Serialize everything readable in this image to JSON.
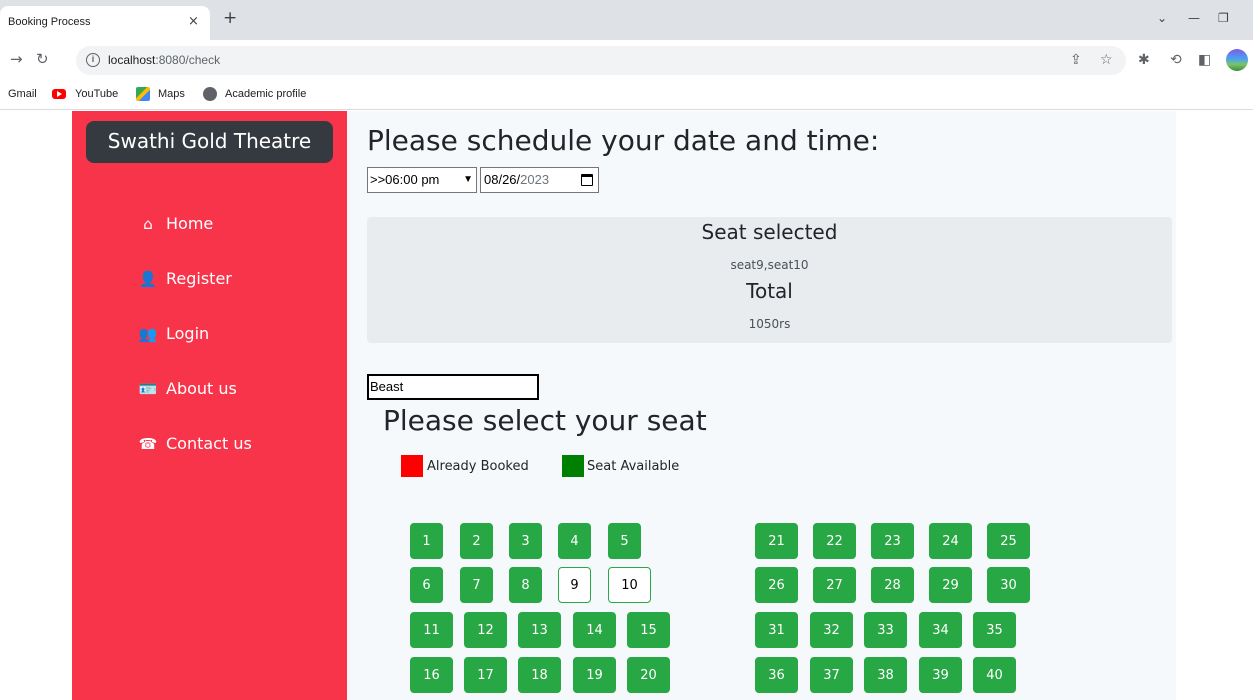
{
  "browser": {
    "tab_title": "Booking Process",
    "tab_close": "×",
    "new_tab": "+",
    "url_host": "localhost",
    "url_rest": ":8080/check",
    "bookmarks": [
      "Gmail",
      "YouTube",
      "Maps",
      "Academic profile"
    ]
  },
  "sidebar": {
    "brand": "Swathi Gold Theatre",
    "items": [
      {
        "label": "Home",
        "icon": "home-icon",
        "glyph": "⌂"
      },
      {
        "label": "Register",
        "icon": "user-plus-icon",
        "glyph": "👤"
      },
      {
        "label": "Login",
        "icon": "users-icon",
        "glyph": "👥"
      },
      {
        "label": "About us",
        "icon": "id-card-icon",
        "glyph": "🪪"
      },
      {
        "label": "Contact us",
        "icon": "phone-icon",
        "glyph": "☎"
      }
    ]
  },
  "schedule": {
    "title": "Please schedule your date and time:",
    "time_value": ">>06:00 pm",
    "date_mmdd": "08/26/",
    "date_year": "2023"
  },
  "summary": {
    "seat_heading": "Seat selected",
    "seats": "seat9,seat10",
    "total_heading": "Total",
    "total_value": "1050rs"
  },
  "movie": {
    "value": "Beast"
  },
  "seat_section": {
    "title": "Please select your seat",
    "legend_booked": "Already Booked",
    "legend_available": "Seat Available",
    "booked_color": "#ff0000",
    "available_color": "#008000",
    "seat_color": "#28a745"
  },
  "seats": {
    "left": [
      [
        "1",
        "2",
        "3",
        "4",
        "5"
      ],
      [
        "6",
        "7",
        "8",
        "9",
        "10"
      ],
      [
        "11",
        "12",
        "13",
        "14",
        "15"
      ],
      [
        "16",
        "17",
        "18",
        "19",
        "20"
      ]
    ],
    "right": [
      [
        "21",
        "22",
        "23",
        "24",
        "25"
      ],
      [
        "26",
        "27",
        "28",
        "29",
        "30"
      ],
      [
        "31",
        "32",
        "33",
        "34",
        "35"
      ],
      [
        "36",
        "37",
        "38",
        "39",
        "40"
      ]
    ],
    "selected": [
      "9",
      "10"
    ]
  }
}
